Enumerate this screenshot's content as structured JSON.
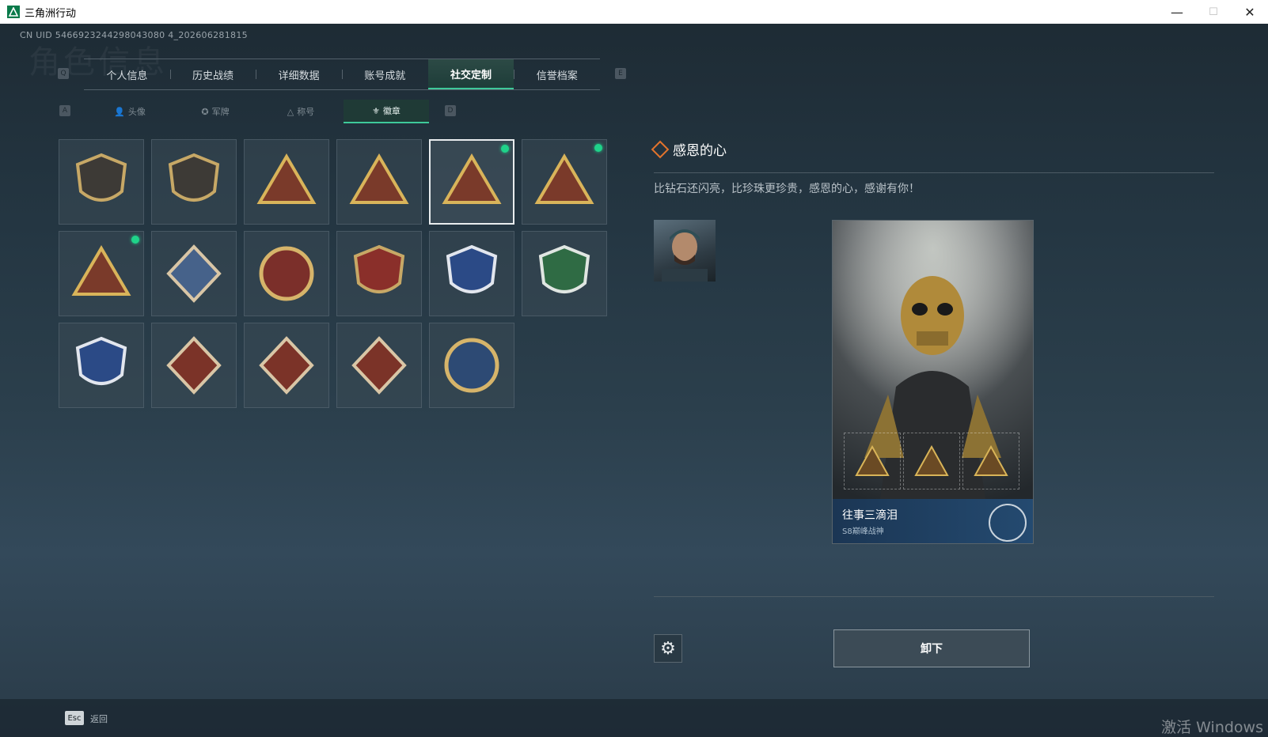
{
  "window": {
    "title": "三角洲行动",
    "minimize": "—",
    "maximize": "☐",
    "close": "✕"
  },
  "uid": "CN UID 5466923244298043080 4_202606281815",
  "bg_title": "角色信息",
  "tabs": {
    "prev_key": "Q",
    "next_key": "E",
    "items": [
      "个人信息",
      "历史战绩",
      "详细数据",
      "账号成就",
      "社交定制",
      "信誉档案"
    ],
    "active": "社交定制"
  },
  "subtabs": {
    "prev_key": "A",
    "next_key": "D",
    "items": [
      {
        "icon": "person-icon",
        "glyph": "👤",
        "label": "头像"
      },
      {
        "icon": "rank-icon",
        "glyph": "✪",
        "label": "军牌"
      },
      {
        "icon": "title-icon",
        "glyph": "△",
        "label": "称号"
      },
      {
        "icon": "medal-icon",
        "glyph": "⚜",
        "label": "徽章"
      }
    ],
    "active": "徽章"
  },
  "badges": [
    {
      "name": "shield-delta-badge",
      "new": false,
      "selected": false
    },
    {
      "name": "helicopter-badge",
      "new": false,
      "selected": false
    },
    {
      "name": "s8-triangle-badge",
      "new": false,
      "selected": false
    },
    {
      "name": "s9-winged-badge",
      "new": false,
      "selected": false
    },
    {
      "name": "grateful-heart-badge",
      "new": true,
      "selected": true
    },
    {
      "name": "soldiers-triangle-badge",
      "new": true,
      "selected": false
    },
    {
      "name": "rocket-triangle-badge",
      "new": true,
      "selected": false
    },
    {
      "name": "rose-diamond-badge",
      "new": false,
      "selected": false
    },
    {
      "name": "star-roundel-badge",
      "new": false,
      "selected": false
    },
    {
      "name": "stars-shield-badge",
      "new": false,
      "selected": false
    },
    {
      "name": "diamond-shield-badge",
      "new": false,
      "selected": false
    },
    {
      "name": "crosshair-shield-badge",
      "new": false,
      "selected": false
    },
    {
      "name": "wing-shield-badge",
      "new": false,
      "selected": false
    },
    {
      "name": "wolf-diamond-badge",
      "new": false,
      "selected": false
    },
    {
      "name": "dragon-diamond-badge",
      "new": false,
      "selected": false
    },
    {
      "name": "runner-diamond-badge",
      "new": false,
      "selected": false
    },
    {
      "name": "lynx-roundel-badge",
      "new": false,
      "selected": false
    }
  ],
  "detail": {
    "title": "感恩的心",
    "description": "比钻石还闪亮，比珍珠更珍贵，感恩的心，感谢有你！",
    "card_name": "往事三滴泪",
    "card_sub": "S8巅峰战神",
    "unequip": "卸下"
  },
  "footer": {
    "esc": "Esc",
    "back": "返回",
    "activate": "激活 Windows"
  },
  "colors": {
    "accent": "#3ec99a",
    "new_dot": "#1fd38a",
    "title_diamond": "#e2732c",
    "card_footer": "#1b3654"
  }
}
